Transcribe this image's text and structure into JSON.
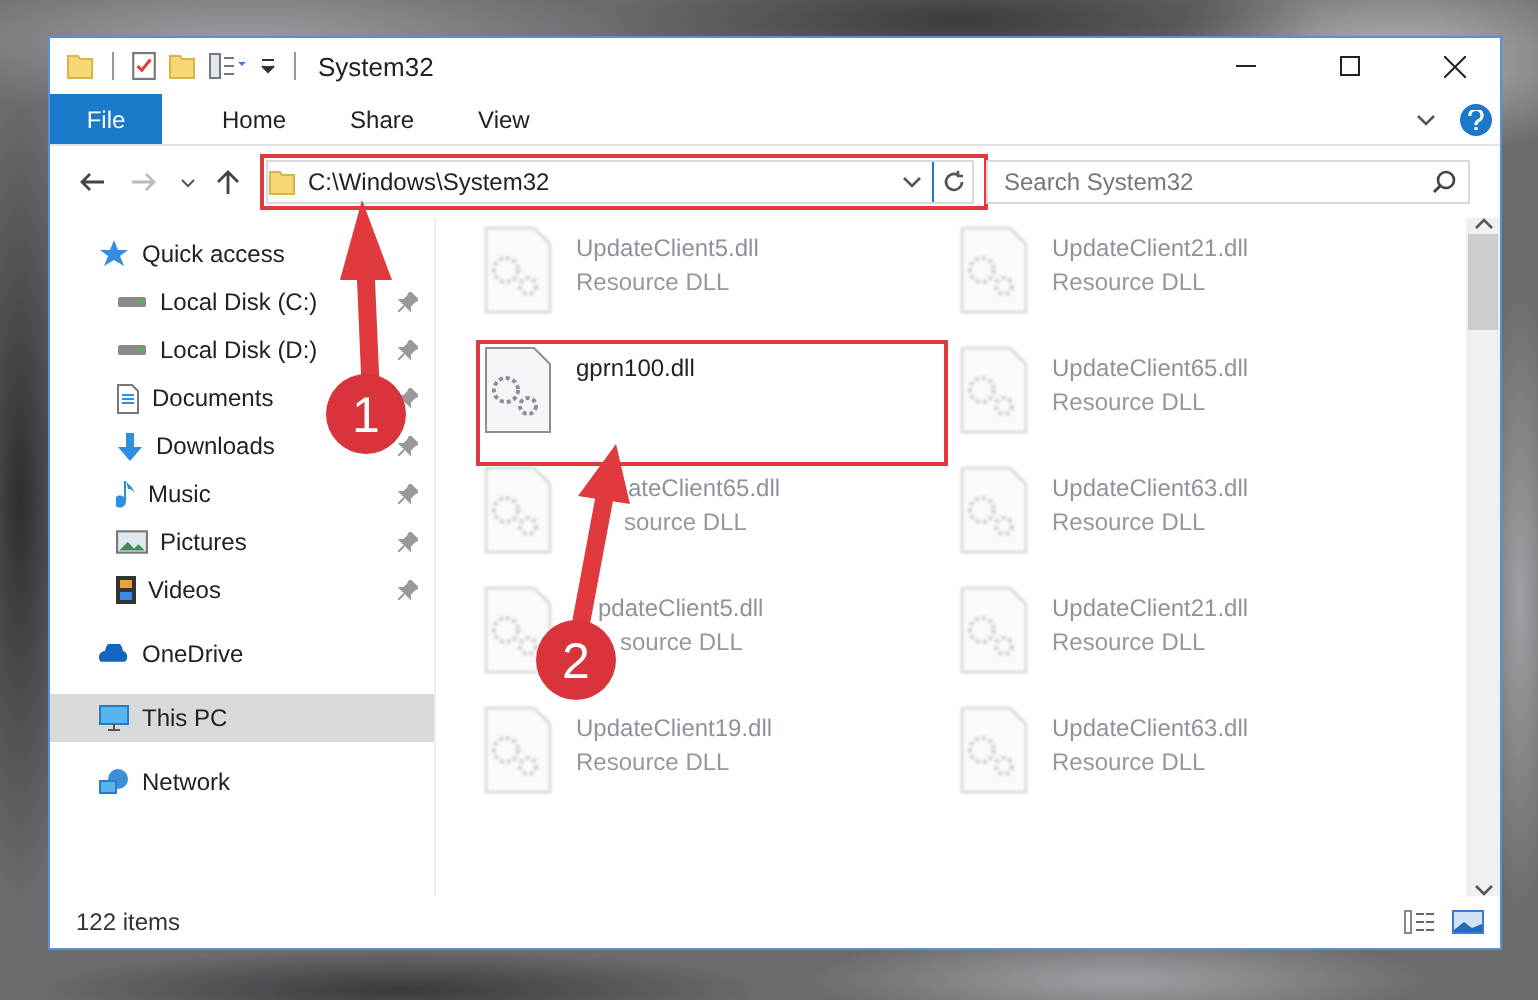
{
  "window": {
    "title": "System32"
  },
  "ribbon_tabs": [
    {
      "label": "File",
      "kind": "file"
    },
    {
      "label": "Home",
      "kind": "tab"
    },
    {
      "label": "Share",
      "kind": "tab"
    },
    {
      "label": "View",
      "kind": "tab"
    }
  ],
  "address_bar": {
    "path": "C:\\Windows\\System32",
    "highlighted": true
  },
  "search": {
    "placeholder": "Search System32"
  },
  "sidebar": {
    "items": [
      {
        "label": "Quick access",
        "selected": false,
        "children": [
          {
            "label": "Local Disk (C:)",
            "pinned": true,
            "selected": false
          },
          {
            "label": "Local Disk (D:)",
            "pinned": true,
            "selected": false
          },
          {
            "label": "Documents",
            "pinned": true,
            "selected": false
          },
          {
            "label": "Downloads",
            "pinned": true,
            "selected": false
          },
          {
            "label": "Music",
            "pinned": true,
            "selected": false
          },
          {
            "label": "Pictures",
            "pinned": true,
            "selected": false
          },
          {
            "label": "Videos",
            "pinned": true,
            "selected": false
          }
        ]
      },
      {
        "label": "OneDrive",
        "selected": false
      },
      {
        "label": "This PC",
        "selected": true
      },
      {
        "label": "Network",
        "selected": false
      }
    ]
  },
  "files": [
    {
      "name": "UpdateClient5.dll",
      "type": "Resource DLL",
      "blurred": true,
      "highlighted": false
    },
    {
      "name": "UpdateClient21.dll",
      "type": "Resource DLL",
      "blurred": true,
      "highlighted": false
    },
    {
      "name": "gprn100.dll",
      "blurred": false,
      "highlighted": true
    },
    {
      "name": "UpdateClient65.dll",
      "type": "Resource DLL",
      "blurred": true,
      "highlighted": false
    },
    {
      "name": "ateClient65.dll",
      "type": "source DLL",
      "blurred": true,
      "highlighted": false
    },
    {
      "name": "UpdateClient63.dll",
      "type": "Resource DLL",
      "blurred": true,
      "highlighted": false
    },
    {
      "name": "pdateClient5.dll",
      "type": "source DLL",
      "blurred": true,
      "highlighted": false
    },
    {
      "name": "UpdateClient21.dll",
      "type": "Resource DLL",
      "blurred": true,
      "highlighted": false
    },
    {
      "name": "UpdateClient19.dll",
      "type": "Resource DLL",
      "blurred": true,
      "highlighted": false
    },
    {
      "name": "UpdateClient63.dll",
      "type": "Resource DLL",
      "blurred": true,
      "highlighted": false
    }
  ],
  "callouts": [
    {
      "label": "1"
    },
    {
      "label": "2"
    }
  ],
  "status_bar": {
    "item_count": "122 items"
  }
}
